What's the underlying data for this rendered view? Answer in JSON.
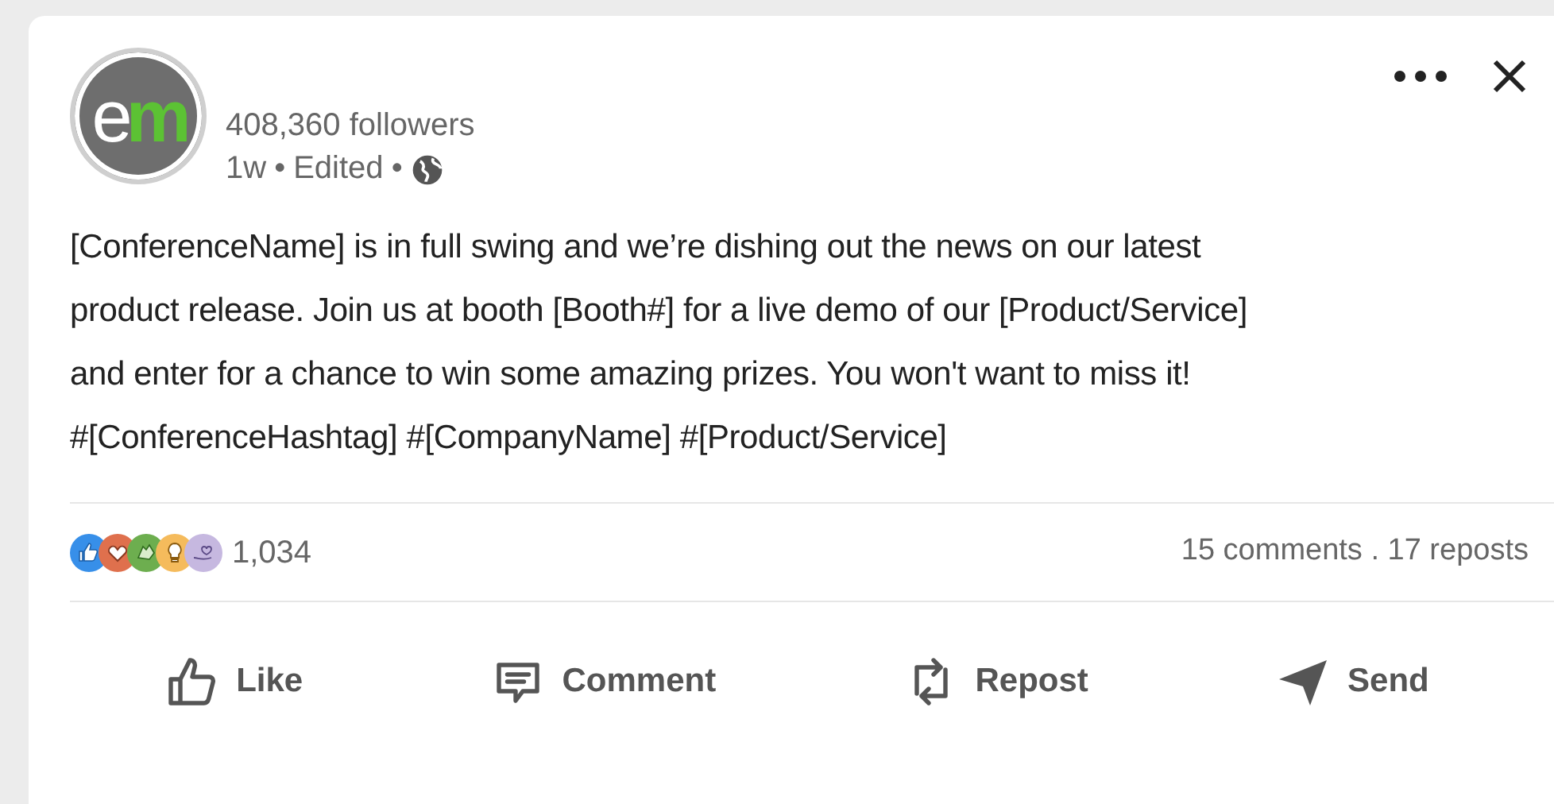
{
  "logo": {
    "letters": [
      {
        "text": "e",
        "color": "#ffffff"
      },
      {
        "text": "m",
        "color": "#5cc234"
      }
    ]
  },
  "author": {
    "followers": "408,360 followers",
    "age": "1w",
    "edited": "Edited",
    "separator": "•"
  },
  "post": {
    "lines": [
      "[ConferenceName] is in full swing and we’re dishing out the news on our latest",
      "product release. Join us at booth [Booth#] for a live demo of our [Product/Service]",
      "and enter for a chance to win some amazing prizes. You won't want to miss it!",
      "#[ConferenceHashtag] #[CompanyName] #[Product/Service]"
    ]
  },
  "reactions": {
    "count": "1,034",
    "kinds": [
      {
        "kind": "like",
        "color": "#378fe9"
      },
      {
        "kind": "love",
        "color": "#df704d"
      },
      {
        "kind": "celebrate",
        "color": "#6dae4f"
      },
      {
        "kind": "insightful",
        "color": "#f5bb5c"
      },
      {
        "kind": "support",
        "color": "#c6b8e0"
      }
    ]
  },
  "stats": "15 comments . 17 reposts",
  "actions": [
    {
      "kind": "like",
      "label": "Like"
    },
    {
      "kind": "comment",
      "label": "Comment"
    },
    {
      "kind": "repost",
      "label": "Repost"
    },
    {
      "kind": "send",
      "label": "Send"
    }
  ]
}
